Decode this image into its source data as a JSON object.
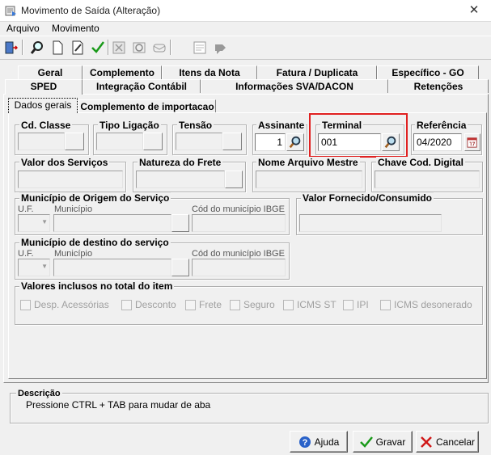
{
  "window": {
    "title": "Movimento de Saída (Alteração)",
    "close": "✕"
  },
  "menu": {
    "items": [
      "Arquivo",
      "Movimento"
    ]
  },
  "tabs": {
    "row1": [
      "Geral",
      "Complemento",
      "Itens da Nota",
      "Fatura / Duplicata",
      "Específico - GO"
    ],
    "row2": [
      "SPED",
      "Integração Contábil",
      "Informações SVA/DACON",
      "Retenções"
    ]
  },
  "subtabs": [
    "Dados gerais",
    "Complemento de importacao"
  ],
  "fields": {
    "cd_classe": "Cd. Classe",
    "tipo_ligacao": "Tipo Ligação",
    "tensao": "Tensão",
    "assinante": {
      "label": "Assinante",
      "value": "1"
    },
    "terminal": {
      "label": "Terminal",
      "value": "001"
    },
    "referencia": {
      "label": "Referência",
      "value": "04/2020"
    },
    "valor_servicos": "Valor dos Serviços",
    "natureza_frete": "Natureza do Frete",
    "nome_arquivo_mestre": "Nome Arquivo Mestre",
    "chave_cod_digital": "Chave Cod. Digital",
    "municipio_origem": {
      "label": "Município de Origem do Serviço",
      "uf": "U.F.",
      "municipio": "Município",
      "ibge": "Cód do município IBGE"
    },
    "valor_fornecido": "Valor Fornecido/Consumido",
    "municipio_destino": {
      "label": "Município de destino do serviço",
      "uf": "U.F.",
      "municipio": "Município",
      "ibge": "Cód do município IBGE"
    },
    "valores_inclusos": {
      "label": "Valores inclusos no total do item",
      "items": [
        "Desp. Acessórias",
        "Desconto",
        "Frete",
        "Seguro",
        "ICMS ST",
        "IPI",
        "ICMS desonerado"
      ]
    }
  },
  "descricao": {
    "label": "Descrição",
    "text": "Pressione CTRL + TAB para  mudar de aba"
  },
  "buttons": {
    "ajuda": "Ajuda",
    "gravar": "Gravar",
    "cancelar": "Cancelar"
  },
  "colors": {
    "highlight": "#e02020",
    "accent_green": "#1a9a1a",
    "help_blue": "#2a62c9",
    "cancel_red": "#d01818"
  },
  "toolbar_icons": [
    "exit-door-icon",
    "search-icon",
    "new-document-icon",
    "edit-document-icon",
    "confirm-check-icon",
    "delete-icon",
    "refresh-icon",
    "email-icon",
    "tax-document-icon",
    "sign-icon",
    "arrow-icon"
  ]
}
